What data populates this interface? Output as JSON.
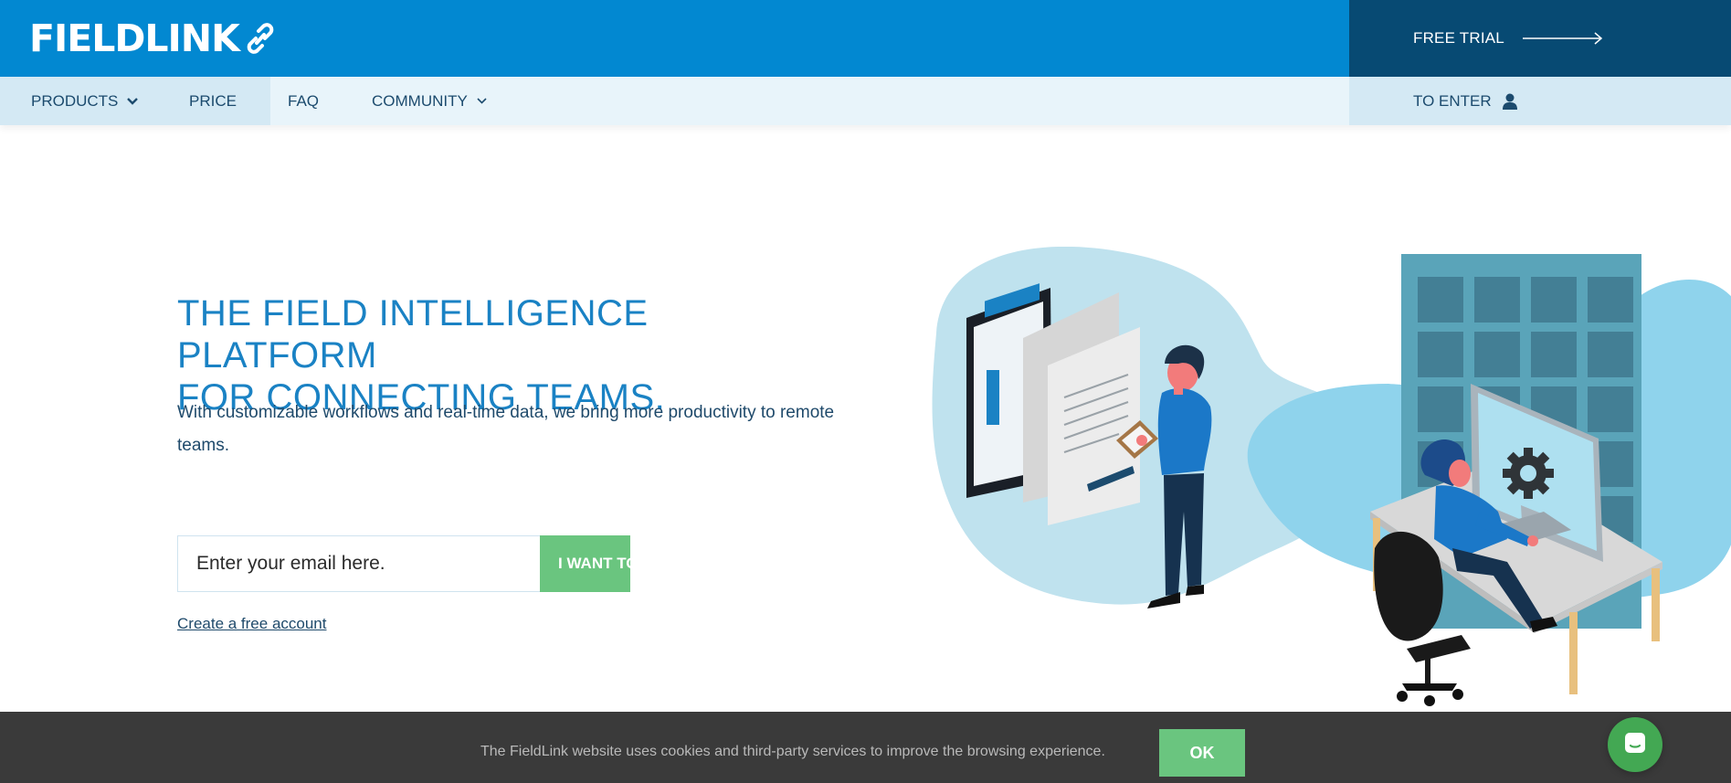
{
  "header": {
    "logo_text": "FIELDLINK",
    "free_trial_label": "FREE TRIAL",
    "colors": {
      "primary": "#0288d1",
      "dark": "#074a73",
      "nav_bg": "#e8f4fa",
      "accent_green": "#6ac57f"
    }
  },
  "nav": {
    "items": [
      {
        "label": "PRODUCTS",
        "icon": "chevron-down-icon"
      },
      {
        "label": "PRICE"
      },
      {
        "label": "FAQ"
      },
      {
        "label": "COMMUNITY",
        "icon": "chevron-down-icon"
      }
    ],
    "enter_label": "TO ENTER",
    "enter_icon": "user-icon"
  },
  "hero": {
    "title_line1": "THE FIELD INTELLIGENCE PLATFORM",
    "title_line2": "FOR CONNECTING TEAMS.",
    "subtitle": "With customizable workflows and real-time data, we bring more productivity to remote teams.",
    "email_placeholder": "Enter your email here.",
    "cta_label": "I WANT TO TRY",
    "create_account_label": "Create a free account"
  },
  "cookie": {
    "text": "The FieldLink website uses cookies and third-party services to improve the browsing experience.",
    "ok_label": "OK"
  },
  "chat": {
    "icon": "chat-icon"
  }
}
